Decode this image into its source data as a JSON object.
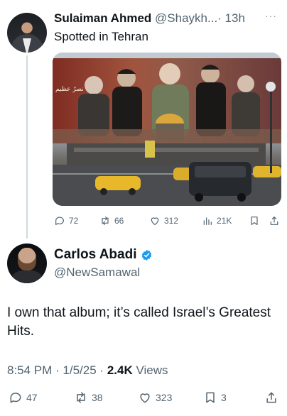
{
  "reply_tweet": {
    "display_name": "Sulaiman Ahmed",
    "handle": "@Shaykh...",
    "time": "· 13h",
    "more": "···",
    "text": "Spotted in Tehran",
    "media_overlay_text": "نصرٌ عظیم",
    "stats": {
      "replies": "72",
      "reposts": "66",
      "likes": "312",
      "views": "21K"
    }
  },
  "main_tweet": {
    "display_name": "Carlos Abadi",
    "handle": "@NewSamawal",
    "verified": true,
    "text": "I own that album; it’s called Israel’s Greatest Hits.",
    "time": "8:54 PM · 1/5/25 ·",
    "views_count": "2.4K",
    "views_label": "Views",
    "stats": {
      "replies": "47",
      "reposts": "38",
      "likes": "323",
      "bookmarks": "3"
    }
  },
  "colors": {
    "text": "#0f1419",
    "muted": "#536471",
    "verified": "#1d9bf0",
    "thread_line": "#cfd9de"
  }
}
